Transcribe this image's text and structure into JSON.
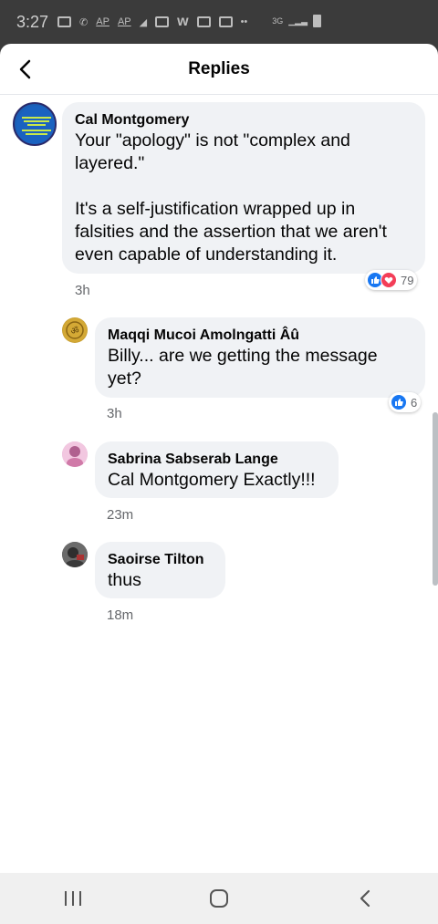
{
  "status_bar": {
    "time": "3:27",
    "icons": [
      "message-icon",
      "wifi-call-icon",
      "ap-icon",
      "ap-icon",
      "chart-icon",
      "cast-icon",
      "w-icon",
      "image-icon",
      "browser-icon",
      "more-icon"
    ],
    "network": "3G"
  },
  "header": {
    "title": "Replies"
  },
  "comments": [
    {
      "author": "Cal Montgomery",
      "text": "Your \"apology\" is not \"complex and layered.\"\n\nIt's a self-justification wrapped up in falsities and the assertion that we aren't even capable of understanding it.",
      "time": "3h",
      "reaction_count": "79"
    },
    {
      "author": "Maqqi Mucoi Amolngatti Âû",
      "text": "Billy... are we getting the message yet?",
      "time": "3h",
      "reaction_count": "6"
    },
    {
      "author": "Sabrina Sabserab Lange",
      "text": "Cal Montgomery Exactly!!!",
      "time": "23m"
    },
    {
      "author": "Saoirse Tilton",
      "text": "thus",
      "time": "18m"
    }
  ],
  "colors": {
    "like_blue": "#1877f2",
    "love_red": "#f33e58",
    "bubble_bg": "#f0f2f5",
    "meta_gray": "#65676b"
  }
}
